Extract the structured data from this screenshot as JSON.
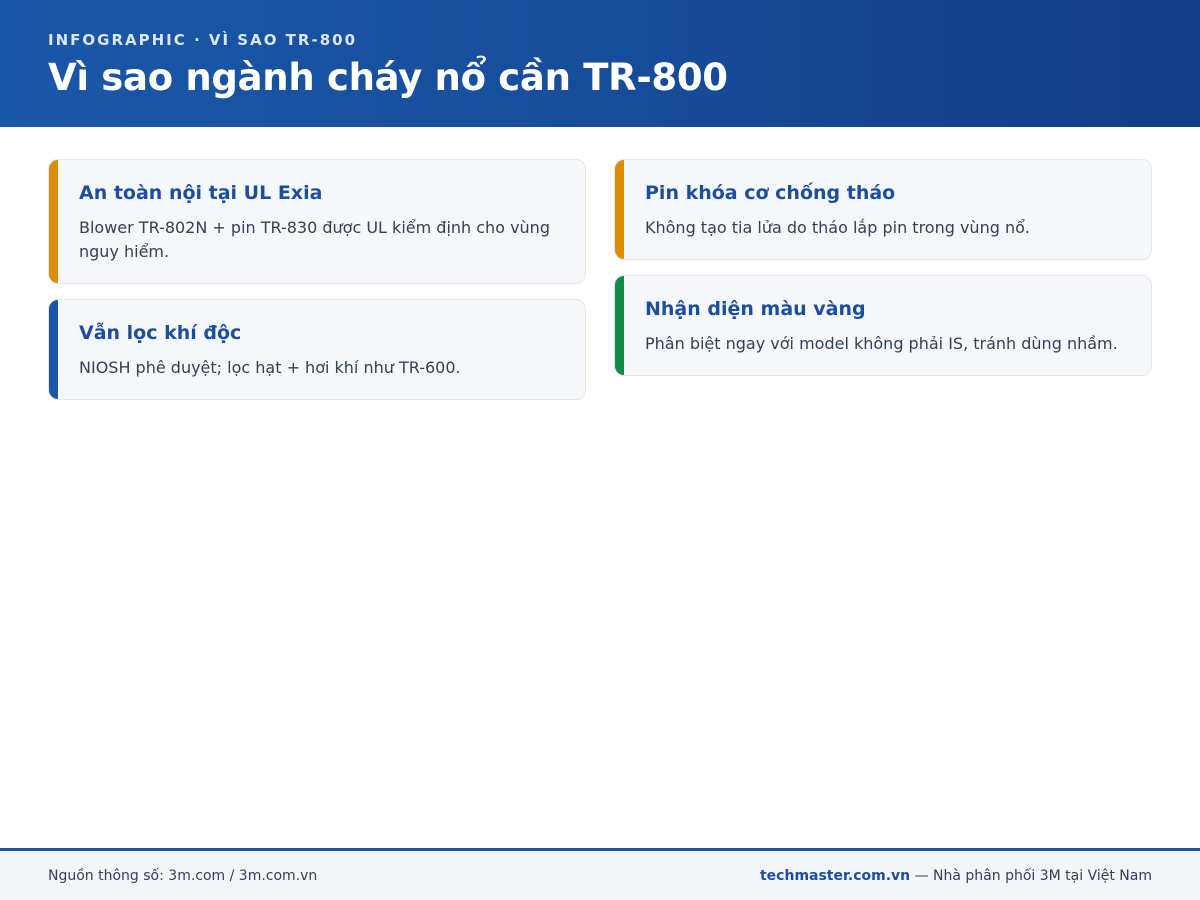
{
  "header": {
    "kicker": "INFOGRAPHIC · VÌ SAO TR-800",
    "title": "Vì sao ngành cháy nổ cần TR-800"
  },
  "colors": {
    "header_bg": "#1b57a8",
    "accent_orange": "#d98f00",
    "accent_blue": "#1b57a8",
    "accent_green": "#138a45",
    "title_text": "#1b4f9c"
  },
  "cards": [
    {
      "title": "An toàn nội tại UL Exia",
      "text": "Blower TR-802N + pin TR-830 được UL kiểm định cho vùng nguy hiểm.",
      "accent": "#d98f00"
    },
    {
      "title": "Pin khóa cơ chống tháo",
      "text": "Không tạo tia lửa do tháo lắp pin trong vùng nổ.",
      "accent": "#d98f00"
    },
    {
      "title": "Vẫn lọc khí độc",
      "text": "NIOSH phê duyệt; lọc hạt + hơi khí như TR-600.",
      "accent": "#1b57a8"
    },
    {
      "title": "Nhận diện màu vàng",
      "text": "Phân biệt ngay với model không phải IS, tránh dùng nhầm.",
      "accent": "#138a45"
    }
  ],
  "footer": {
    "source": "Nguồn thông số: 3m.com / 3m.com.vn",
    "brand": "techmaster.com.vn",
    "tagline": " — Nhà phân phối 3M tại Việt Nam"
  }
}
